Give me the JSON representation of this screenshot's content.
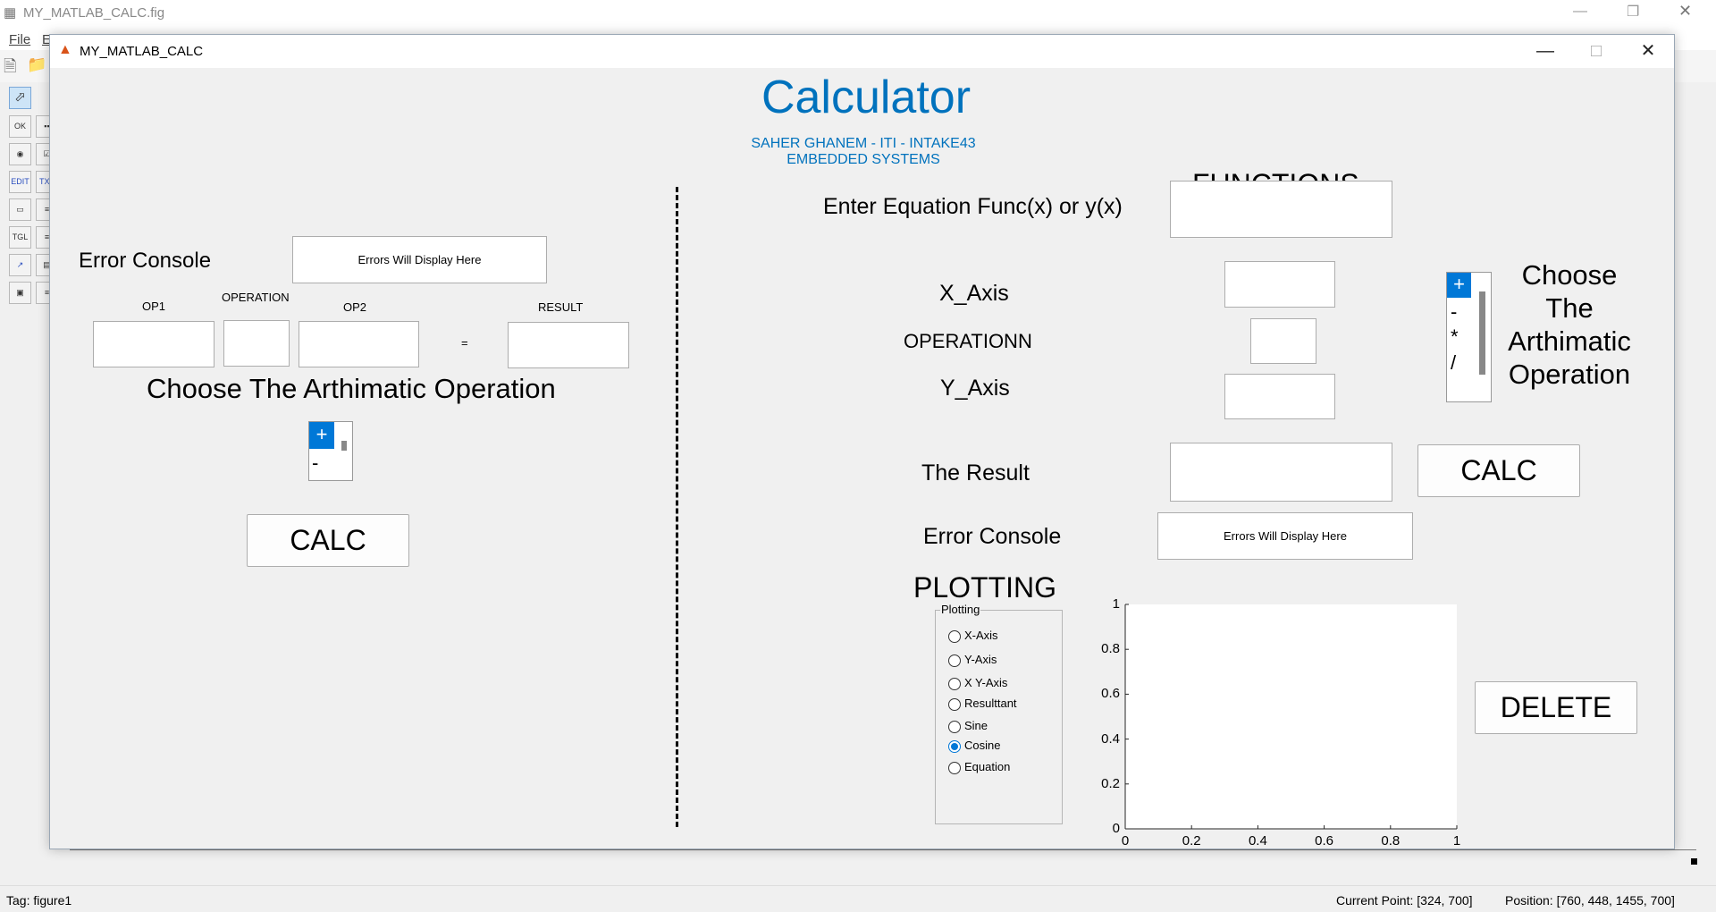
{
  "guide": {
    "title": "MY_MATLAB_CALC.fig",
    "menu": {
      "file": "File",
      "edit": "E"
    },
    "palette": [
      "OK",
      "▪▪",
      "◉",
      "☑",
      "EDIT",
      "TXT",
      "▭",
      "≡",
      "TGL",
      "≡",
      "↗",
      "▤",
      "▣",
      "≡"
    ],
    "status": {
      "tag": "Tag: figure1",
      "current_point": "Current Point:  [324, 700]",
      "position": "Position: [760, 448, 1455, 700]"
    }
  },
  "window": {
    "title": "MY_MATLAB_CALC",
    "minimize": "—",
    "maximize": "□",
    "close": "✕"
  },
  "header": {
    "title": "Calculator",
    "author": "SAHER GHANEM - ITI - INTAKE43",
    "track": "EMBEDDED SYSTEMS",
    "title_color": "#0072bd"
  },
  "left": {
    "error_label": "Error Console",
    "error_box": "Errors Will Display Here",
    "op1_label": "OP1",
    "operation_label": "OPERATION",
    "op2_label": "OP2",
    "result_label": "RESULT",
    "equals": "=",
    "op1_value": "",
    "operation_value": "",
    "op2_value": "",
    "result_value": "",
    "choose_label": "Choose The Arthimatic Operation",
    "operations": [
      "+",
      "-"
    ],
    "selected_operation": "+",
    "calc_button": "CALC"
  },
  "right": {
    "functions_title": "FUNCTIONS",
    "equation_label": "Enter Equation Func(x) or y(x)",
    "equation_value": "",
    "x_axis_label": "X_Axis",
    "x_axis_value": "",
    "operation_label": "OPERATIONN",
    "operation_value": "",
    "y_axis_label": "Y_Axis",
    "y_axis_value": "",
    "operations": [
      "+",
      "-",
      "*",
      "/"
    ],
    "selected_operation": "+",
    "choose_lines": [
      "Choose",
      "The",
      "Arthimatic",
      "Operation"
    ],
    "result_label": "The Result",
    "result_value": "",
    "calc_button": "CALC",
    "error_label": "Error Console",
    "error_box": "Errors Will Display Here",
    "plotting_title": "PLOTTING",
    "delete_button": "DELETE"
  },
  "plotting_panel": {
    "title": "Plotting",
    "options": [
      {
        "label": "X-Axis",
        "selected": false
      },
      {
        "label": "Y-Axis",
        "selected": false
      },
      {
        "label": "X Y-Axis",
        "selected": false
      },
      {
        "label": "Resulttant",
        "selected": false
      },
      {
        "label": "Sine",
        "selected": false
      },
      {
        "label": "Cosine",
        "selected": true
      },
      {
        "label": "Equation",
        "selected": false
      }
    ]
  },
  "chart_data": {
    "type": "line",
    "series": [],
    "xlim": [
      0,
      1
    ],
    "ylim": [
      0,
      1
    ],
    "x_ticks": [
      "0",
      "0.2",
      "0.4",
      "0.6",
      "0.8",
      "1"
    ],
    "y_ticks": [
      "0",
      "0.2",
      "0.4",
      "0.6",
      "0.8",
      "1"
    ],
    "title": "",
    "xlabel": "",
    "ylabel": "",
    "grid": false
  }
}
